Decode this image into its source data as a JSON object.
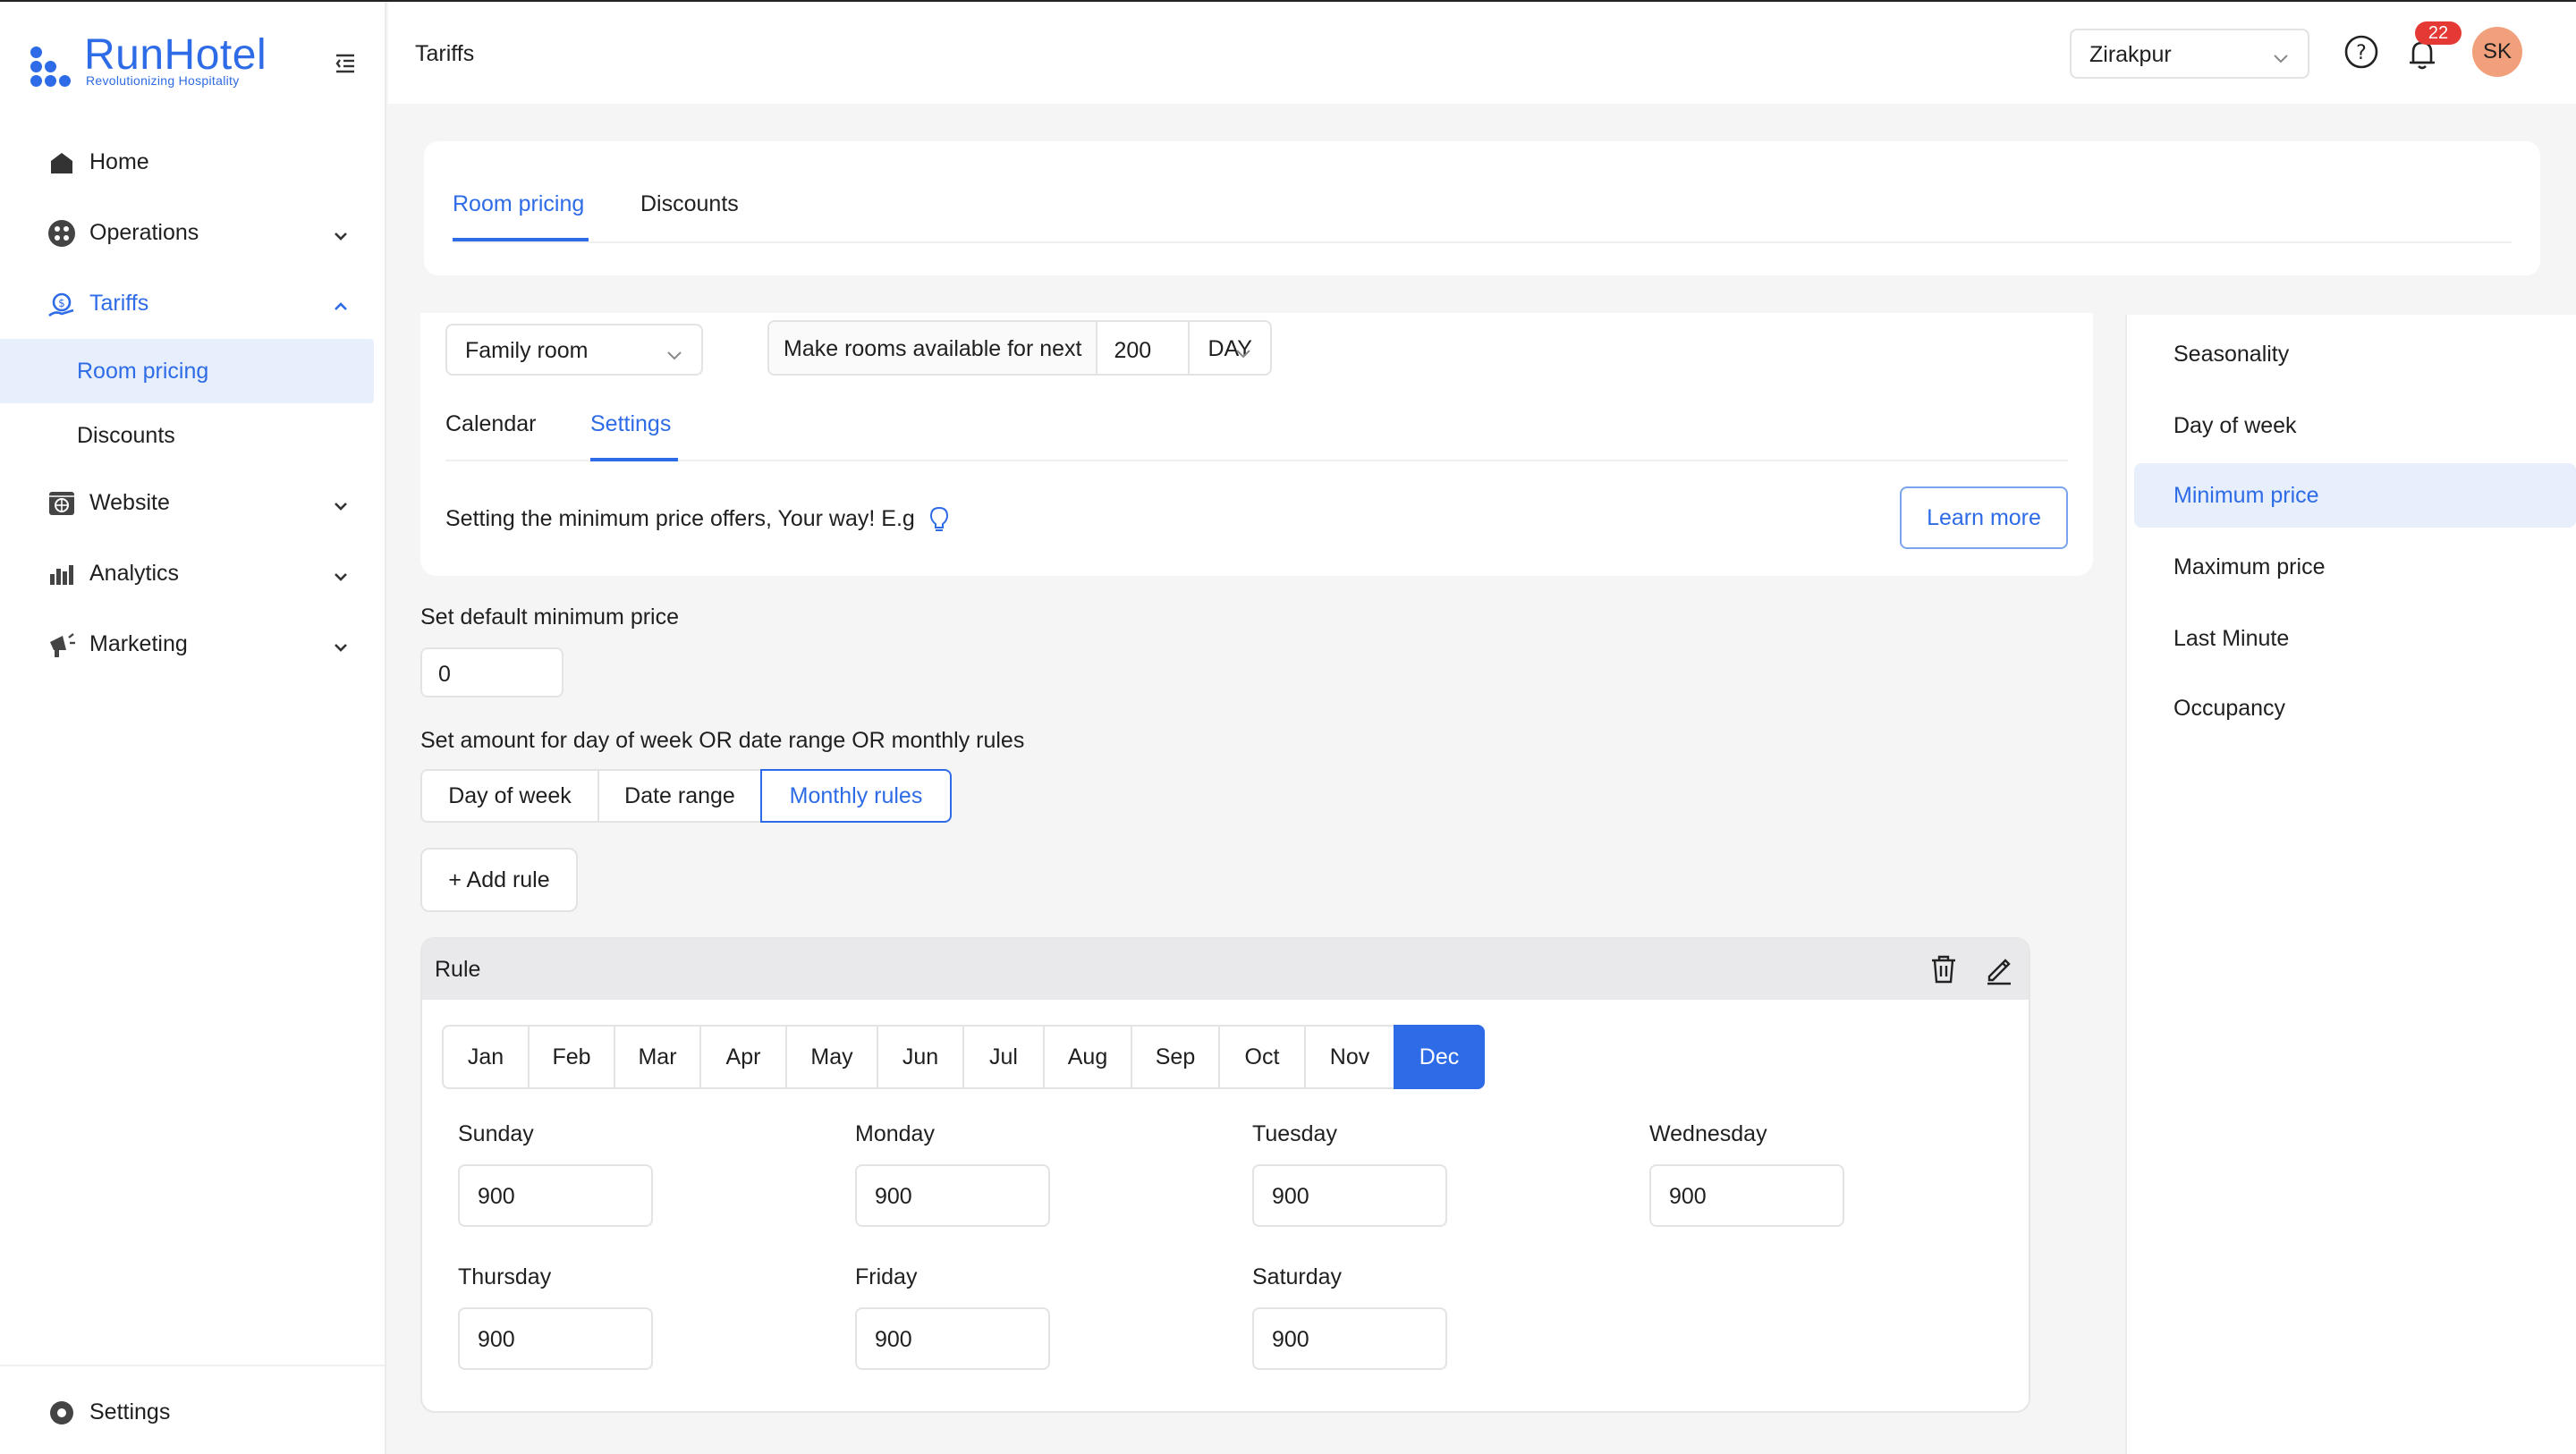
{
  "brand": {
    "name": "RunHotel",
    "tagline": "Revolutionizing Hospitality",
    "accent": "#2e6be6"
  },
  "sidebar": {
    "items": [
      {
        "label": "Home",
        "icon": "home-icon"
      },
      {
        "label": "Operations",
        "icon": "operations-icon"
      },
      {
        "label": "Tariffs",
        "icon": "tariffs-icon",
        "expanded": true,
        "children": [
          {
            "label": "Room pricing",
            "selected": true
          },
          {
            "label": "Discounts"
          }
        ]
      },
      {
        "label": "Website",
        "icon": "website-icon"
      },
      {
        "label": "Analytics",
        "icon": "analytics-icon"
      },
      {
        "label": "Marketing",
        "icon": "marketing-icon"
      }
    ],
    "bottom": {
      "label": "Settings",
      "icon": "settings-icon"
    }
  },
  "header": {
    "title": "Tariffs",
    "location": "Zirakpur",
    "notifications": "22",
    "avatar": "SK"
  },
  "tabs": [
    {
      "label": "Room pricing",
      "active": true
    },
    {
      "label": "Discounts"
    }
  ],
  "room_select": "Family room",
  "availability": {
    "label": "Make rooms available for next",
    "value": "200",
    "unit": "DAY"
  },
  "subtabs": [
    {
      "label": "Calendar"
    },
    {
      "label": "Settings",
      "active": true
    }
  ],
  "info": {
    "text": "Setting the minimum price offers, Your way! E.g",
    "learn_more": "Learn more"
  },
  "default_price": {
    "label": "Set default minimum price",
    "value": "0"
  },
  "rules_section": {
    "label": "Set amount for day of week OR date range OR monthly rules",
    "modes": [
      "Day of week",
      "Date range",
      "Monthly rules"
    ],
    "active_mode": "Monthly rules",
    "add_rule": "+ Add rule"
  },
  "rule": {
    "title": "Rule",
    "months": [
      "Jan",
      "Feb",
      "Mar",
      "Apr",
      "May",
      "Jun",
      "Jul",
      "Aug",
      "Sep",
      "Oct",
      "Nov",
      "Dec"
    ],
    "selected_month": "Dec",
    "days": [
      {
        "label": "Sunday",
        "value": "900"
      },
      {
        "label": "Monday",
        "value": "900"
      },
      {
        "label": "Tuesday",
        "value": "900"
      },
      {
        "label": "Wednesday",
        "value": "900"
      },
      {
        "label": "Thursday",
        "value": "900"
      },
      {
        "label": "Friday",
        "value": "900"
      },
      {
        "label": "Saturday",
        "value": "900"
      }
    ]
  },
  "right_menu": {
    "items": [
      "Seasonality",
      "Day of week",
      "Minimum price",
      "Maximum price",
      "Last Minute",
      "Occupancy"
    ],
    "selected": "Minimum price"
  }
}
